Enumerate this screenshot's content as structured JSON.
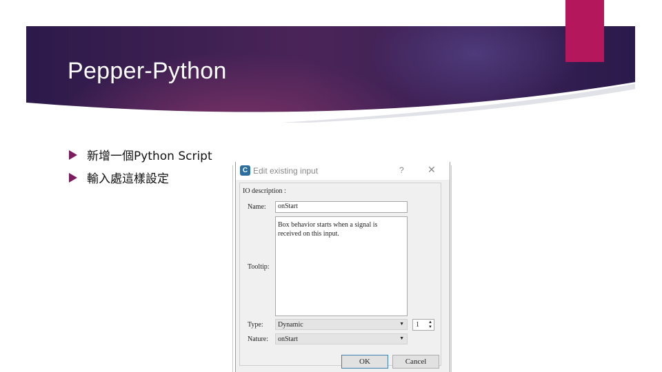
{
  "slide": {
    "title": "Pepper-Python",
    "bullets": [
      {
        "text": "新增一個Python Script"
      },
      {
        "text": "輸入處這樣設定"
      }
    ],
    "accent_color": "#b5175c",
    "bullet_color": "#7a1c5e"
  },
  "dialog": {
    "app_icon": "C",
    "title": "Edit existing input",
    "help_label": "?",
    "close_label": "✕",
    "group_label": "IO description :",
    "name_label": "Name:",
    "name_value": "onStart",
    "tooltip_label": "Tooltip:",
    "tooltip_value": "Box behavior starts when a signal is\nreceived on this input.",
    "type_label": "Type:",
    "type_value": "Dynamic",
    "type_size_value": "1",
    "nature_label": "Nature:",
    "nature_value": "onStart",
    "ok_label": "OK",
    "cancel_label": "Cancel"
  }
}
